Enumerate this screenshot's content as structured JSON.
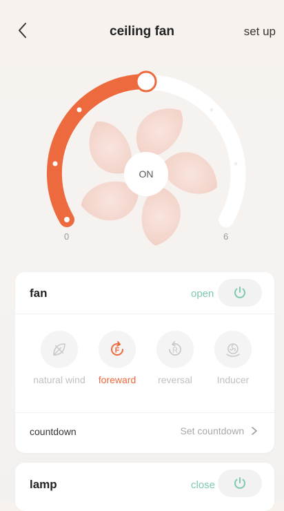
{
  "header": {
    "title": "ceiling fan",
    "setup_label": "set up"
  },
  "dial": {
    "center_label": "ON",
    "min_label": "0",
    "max_label": "6",
    "level": 3,
    "max_level": 6
  },
  "fan_card": {
    "title": "fan",
    "status": "open",
    "modes": [
      {
        "label": "natural wind",
        "icon": "leaf-icon",
        "active": false
      },
      {
        "label": "foreward",
        "icon": "forward-rotation-icon",
        "active": true
      },
      {
        "label": "reversal",
        "icon": "reverse-rotation-icon",
        "active": false
      },
      {
        "label": "Inducer",
        "icon": "inducer-icon",
        "active": false
      }
    ],
    "countdown_label": "countdown",
    "countdown_value": "Set countdown"
  },
  "lamp_card": {
    "title": "lamp",
    "status": "close"
  },
  "colors": {
    "accent": "#ec6a3d",
    "status_green": "#7ec9ad",
    "muted": "#c0c0c0"
  }
}
